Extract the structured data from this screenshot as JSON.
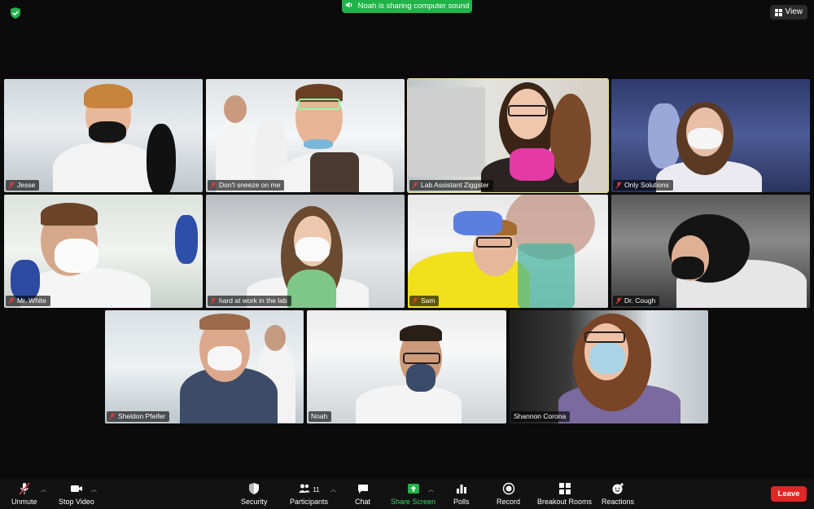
{
  "banner": {
    "text": "Noah is sharing computer sound"
  },
  "view_button": {
    "label": "View"
  },
  "participants": [
    {
      "name": "Jesse",
      "active": false
    },
    {
      "name": "Don't sneeze on me",
      "active": false
    },
    {
      "name": "Lab Assistant Ziggster",
      "active": true
    },
    {
      "name": "Only Solutions",
      "active": false
    },
    {
      "name": "Mr. White",
      "active": false
    },
    {
      "name": "hard at work in the lab",
      "active": false
    },
    {
      "name": "Sam",
      "active": false
    },
    {
      "name": "Dr. Cough",
      "active": false
    },
    {
      "name": "Sheldon Pfeifer",
      "active": false
    },
    {
      "name": "Noah",
      "active": false
    },
    {
      "name": "Shannon Corona",
      "active": false
    }
  ],
  "toolbar": {
    "unmute": "Unmute",
    "stop_video": "Stop Video",
    "security": "Security",
    "participants": "Participants",
    "participants_count": "11",
    "chat": "Chat",
    "share_screen": "Share Screen",
    "polls": "Polls",
    "record": "Record",
    "breakout_rooms": "Breakout Rooms",
    "reactions": "Reactions",
    "leave": "Leave"
  },
  "colors": {
    "accent_green": "#20b34a",
    "active_speaker_border": "#e8e377",
    "leave_red": "#e02828"
  }
}
